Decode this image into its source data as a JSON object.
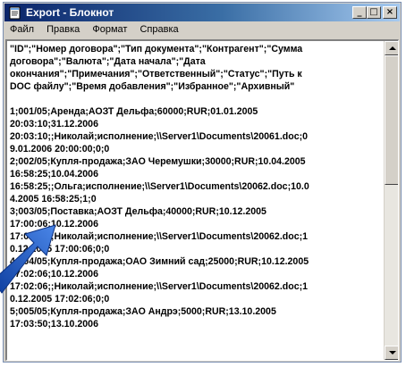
{
  "window": {
    "title": "Export - Блокнот",
    "controls": {
      "minimize": "_",
      "maximize": "□",
      "close": "×"
    }
  },
  "menu": [
    "Файл",
    "Правка",
    "Формат",
    "Справка"
  ],
  "editor": {
    "lines": [
      "\"ID\";\"Номер договора\";\"Тип документа\";\"Контрагент\";\"Сумма",
      "договора\";\"Валюта\";\"Дата начала\";\"Дата",
      "окончания\";\"Примечания\";\"Ответственный\";\"Статус\";\"Путь к",
      "DOC файлу\";\"Время добавления\";\"Избранное\";\"Архивный\"",
      "",
      "1;001/05;Аренда;АОЗТ Дельфа;60000;RUR;01.01.2005",
      "20:03:10;31.12.2006",
      "20:03:10;;Николай;исполнение;\\\\Server1\\Documents\\20061.doc;0",
      "9.01.2006 20:00:00;0;0",
      "2;002/05;Купля-продажа;ЗАО Черемушки;30000;RUR;10.04.2005",
      "16:58:25;10.04.2006",
      "16:58:25;;Ольга;исполнение;\\\\Server1\\Documents\\20062.doc;10.0",
      "4.2005 16:58:25;1;0",
      "3;003/05;Поставка;АОЗТ Дельфа;40000;RUR;10.12.2005",
      "17:00:06;10.12.2006",
      "17:00:06;;Николай;исполнение;\\\\Server1\\Documents\\20062.doc;1",
      "0.12.2005 17:00:06;0;0",
      "4;004/05;Купля-продажа;ОАО Зимний сад;25000;RUR;10.12.2005",
      "17:02:06;10.12.2006",
      "17:02:06;;Николай;исполнение;\\\\Server1\\Documents\\20062.doc;1",
      "0.12.2005 17:02:06;0;0",
      "5;005/05;Купля-продажа;ЗАО Андрэ;5000;RUR;13.10.2005",
      "17:03:50;13.10.2006"
    ]
  },
  "colors": {
    "arrow": "#1f57c3",
    "title_active": "#0a246a"
  }
}
